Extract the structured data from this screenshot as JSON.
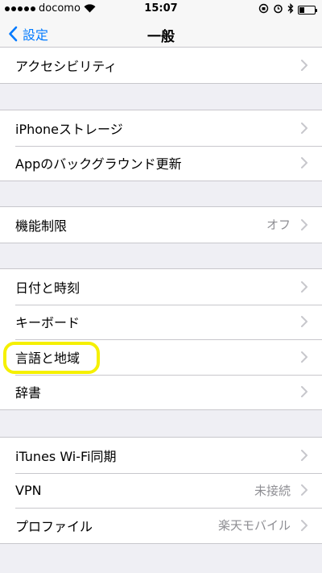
{
  "status_bar": {
    "carrier": "docomo",
    "time": "15:07"
  },
  "nav": {
    "back_label": "設定",
    "title": "一般"
  },
  "groups": [
    {
      "rows": [
        {
          "label": "アクセシビリティ",
          "value": ""
        }
      ]
    },
    {
      "rows": [
        {
          "label": "iPhoneストレージ",
          "value": ""
        },
        {
          "label": "Appのバックグラウンド更新",
          "value": ""
        }
      ]
    },
    {
      "rows": [
        {
          "label": "機能制限",
          "value": "オフ"
        }
      ]
    },
    {
      "rows": [
        {
          "label": "日付と時刻",
          "value": ""
        },
        {
          "label": "キーボード",
          "value": ""
        },
        {
          "label": "言語と地域",
          "value": ""
        },
        {
          "label": "辞書",
          "value": ""
        }
      ]
    },
    {
      "rows": [
        {
          "label": "iTunes Wi-Fi同期",
          "value": ""
        },
        {
          "label": "VPN",
          "value": "未接続"
        },
        {
          "label": "プロファイル",
          "value": "楽天モバイル"
        }
      ]
    }
  ],
  "colors": {
    "accent": "#007aff",
    "highlight": "#f5f000",
    "background": "#efeff4"
  }
}
